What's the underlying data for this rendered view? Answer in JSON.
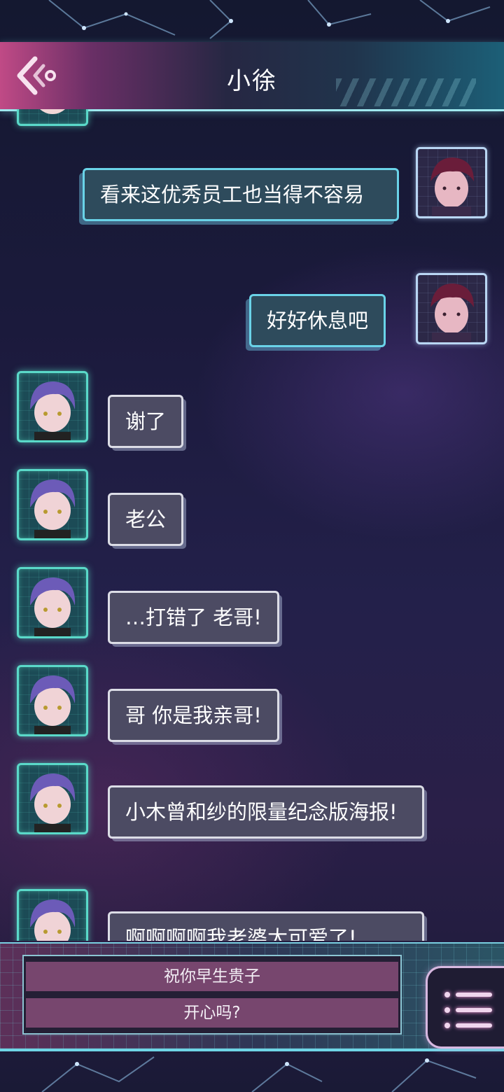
{
  "header": {
    "title": "小徐",
    "back_icon": "back-chevron-icon"
  },
  "colors": {
    "header_pink": "#c04a86",
    "header_cyan": "#1c5f77",
    "npc_frame": "#5ad9c9",
    "npc_bubble": "#4c4b63",
    "player_bubble": "#2e4b5c",
    "choice_bg": "#77466e"
  },
  "messages": [
    {
      "sender": "player",
      "text": "看来这优秀员工也当得不容易"
    },
    {
      "sender": "player",
      "text": "好好休息吧"
    },
    {
      "sender": "npc",
      "text": "谢了"
    },
    {
      "sender": "npc",
      "text": "老公"
    },
    {
      "sender": "npc",
      "text": "…打错了 老哥!"
    },
    {
      "sender": "npc",
      "text": "哥 你是我亲哥!"
    },
    {
      "sender": "npc",
      "text": "小木曾和纱的限量纪念版海报!"
    },
    {
      "sender": "npc",
      "text": "啊啊啊啊我老婆太可爱了!"
    }
  ],
  "choices": [
    {
      "label": "祝你早生贵子"
    },
    {
      "label": "开心吗?"
    }
  ],
  "menu": {
    "icon": "list-menu-icon"
  }
}
